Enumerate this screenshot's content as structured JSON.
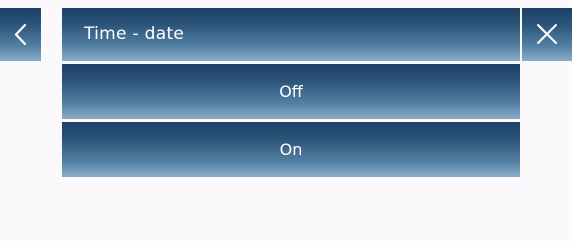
{
  "header": {
    "title": "Time - date",
    "back_icon": "chevron-left-icon",
    "close_icon": "close-icon"
  },
  "options": [
    {
      "label": "Off"
    },
    {
      "label": "On"
    }
  ],
  "colors": {
    "background": "#fcf9fc",
    "bar_top": "#1d3f66",
    "bar_bottom": "#8aaec8",
    "text": "#ffffff"
  }
}
